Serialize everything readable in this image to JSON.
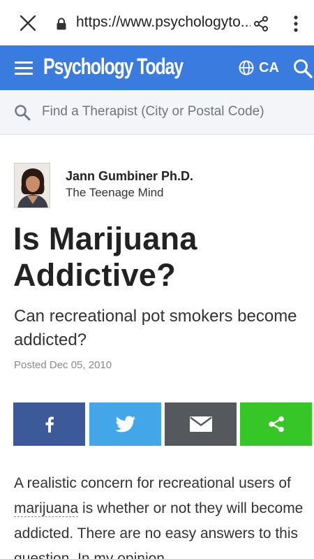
{
  "browser": {
    "url": "https://www.psychologyto..."
  },
  "site": {
    "logo": "Psychology Today",
    "region": "CA",
    "brand_color": "#3a7be0"
  },
  "finder": {
    "placeholder": "Find a Therapist (City or Postal Code)"
  },
  "author": {
    "name": "Jann Gumbiner Ph.D.",
    "blog": "The Teenage Mind"
  },
  "article": {
    "title_line1": "Is Marijuana",
    "title_line2": "Addictive?",
    "subtitle": "Can recreational pot smokers become addicted?",
    "posted": "Posted Dec 05, 2010",
    "body_before": "A realistic concern for recreational users of ",
    "body_term": "marijuana",
    "body_after": " is whether or not they will become addicted. There are no easy answers to this question. In my opinion"
  },
  "share_buttons": {
    "facebook_color": "#3c5a99",
    "twitter_color": "#42a6e8",
    "email_color": "#55585c",
    "share_color": "#36c628",
    "icons": [
      "facebook-icon",
      "twitter-icon",
      "email-icon",
      "share-icon"
    ]
  }
}
